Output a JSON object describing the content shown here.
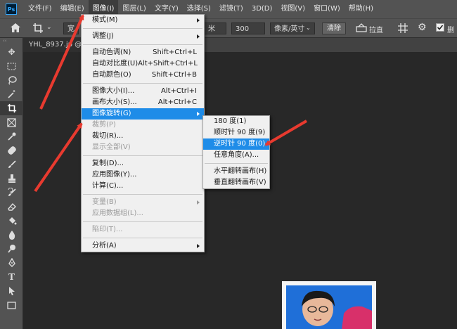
{
  "app": {
    "logo": "Ps"
  },
  "menubar": [
    "文件(F)",
    "编辑(E)",
    "图像(I)",
    "图层(L)",
    "文字(Y)",
    "选择(S)",
    "滤镜(T)",
    "3D(D)",
    "视图(V)",
    "窗口(W)",
    "帮助(H)"
  ],
  "options": {
    "crop_icon": "crop-icon",
    "ratio_label": "宽",
    "width_value": "米",
    "resolution_value": "300",
    "unit_value": "像素/英寸",
    "clear_label": "清除",
    "straighten_label": "拉直",
    "delete_label": "删"
  },
  "document": {
    "tab_label": "YHL_8937.jp @"
  },
  "image_menu": {
    "items": [
      {
        "label": "模式(M)",
        "shortcut": "",
        "submenu": true,
        "disabled": false
      },
      {
        "sep": true
      },
      {
        "label": "调整(J)",
        "shortcut": "",
        "submenu": true,
        "disabled": false
      },
      {
        "sep": true
      },
      {
        "label": "自动色调(N)",
        "shortcut": "Shift+Ctrl+L",
        "disabled": false
      },
      {
        "label": "自动对比度(U)",
        "shortcut": "Alt+Shift+Ctrl+L",
        "disabled": false
      },
      {
        "label": "自动颜色(O)",
        "shortcut": "Shift+Ctrl+B",
        "disabled": false
      },
      {
        "sep": true
      },
      {
        "label": "图像大小(I)...",
        "shortcut": "Alt+Ctrl+I",
        "disabled": false
      },
      {
        "label": "画布大小(S)...",
        "shortcut": "Alt+Ctrl+C",
        "disabled": false
      },
      {
        "label": "图像旋转(G)",
        "shortcut": "",
        "submenu": true,
        "highlighted": true,
        "disabled": false
      },
      {
        "label": "裁剪(P)",
        "shortcut": "",
        "disabled": true
      },
      {
        "label": "裁切(R)...",
        "shortcut": "",
        "disabled": false
      },
      {
        "label": "显示全部(V)",
        "shortcut": "",
        "disabled": true
      },
      {
        "sep": true
      },
      {
        "label": "复制(D)...",
        "shortcut": "",
        "disabled": false
      },
      {
        "label": "应用图像(Y)...",
        "shortcut": "",
        "disabled": false
      },
      {
        "label": "计算(C)...",
        "shortcut": "",
        "disabled": false
      },
      {
        "sep": true
      },
      {
        "label": "变量(B)",
        "shortcut": "",
        "submenu": true,
        "disabled": true
      },
      {
        "label": "应用数据组(L)...",
        "shortcut": "",
        "disabled": true
      },
      {
        "sep": true
      },
      {
        "label": "陷印(T)...",
        "shortcut": "",
        "disabled": true
      },
      {
        "sep": true
      },
      {
        "label": "分析(A)",
        "shortcut": "",
        "submenu": true,
        "disabled": false
      }
    ]
  },
  "rotate_submenu": {
    "items": [
      {
        "label": "180 度(1)"
      },
      {
        "label": "顺时针 90 度(9)"
      },
      {
        "label": "逆时针 90 度(0)",
        "highlighted": true
      },
      {
        "label": "任意角度(A)..."
      },
      {
        "sep": true
      },
      {
        "label": "水平翻转画布(H)"
      },
      {
        "label": "垂直翻转画布(V)"
      }
    ]
  },
  "colors": {
    "highlight": "#1e8ce8",
    "annotation_arrow": "#e83a2f",
    "photo_background": "#1f6fd8"
  }
}
